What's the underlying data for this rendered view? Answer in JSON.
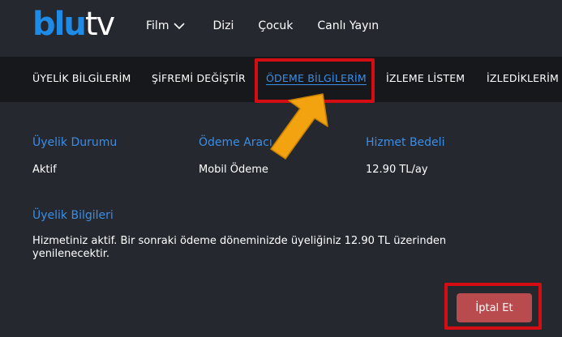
{
  "logo": {
    "part1": "blu",
    "part2": "tv"
  },
  "topnav": {
    "items": [
      {
        "label": "Film",
        "has_dropdown": true
      },
      {
        "label": "Dizi"
      },
      {
        "label": "Çocuk"
      },
      {
        "label": "Canlı Yayın"
      }
    ]
  },
  "tabs": [
    {
      "label": "ÜYELİK BİLGİLERİM"
    },
    {
      "label": "ŞİFREMİ DEĞİŞTİR"
    },
    {
      "label": "ÖDEME BİLGİLERİM",
      "active": true
    },
    {
      "label": "İZLEME LİSTEM"
    },
    {
      "label": "İZLEDİKLERİM"
    }
  ],
  "details": {
    "membership_status_label": "Üyelik Durumu",
    "membership_status_value": "Aktif",
    "payment_method_label": "Ödeme Aracı",
    "payment_method_value": "Mobil Ödeme",
    "service_fee_label": "Hizmet Bedeli",
    "service_fee_value": "12.90 TL/ay"
  },
  "membership_info": {
    "label": "Üyelik Bilgileri",
    "text": "Hizmetiniz aktif. Bir sonraki ödeme döneminizde üyeliğiniz 12.90 TL üzerinden yenilenecektir."
  },
  "cancel_button": {
    "label": "İptal Et"
  },
  "colors": {
    "background": "#262830",
    "tabbar": "#17181c",
    "accent_blue": "#3a8ee6",
    "highlight_red": "#d40d12",
    "cancel_button": "#b94a4d",
    "arrow_orange": "#f2a30f"
  }
}
